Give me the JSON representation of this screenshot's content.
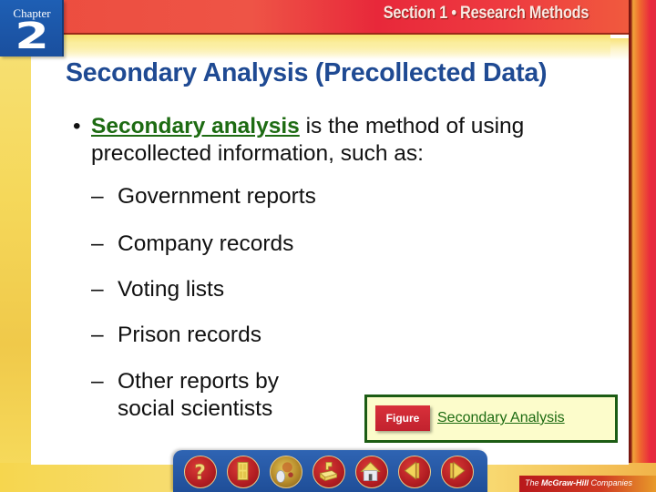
{
  "header": {
    "chapter_label": "Chapter",
    "chapter_number": "2",
    "section_title": "Section 1 • Research Methods"
  },
  "slide": {
    "title": "Secondary Analysis (Precollected Data)",
    "bullet": {
      "marker": "•",
      "term": "Secondary analysis",
      "text_after_term": " is the method of using precollected information, such as:"
    },
    "sub_items": [
      {
        "marker": "–",
        "text": "Government reports"
      },
      {
        "marker": "–",
        "text": "Company records"
      },
      {
        "marker": "–",
        "text": "Voting lists"
      },
      {
        "marker": "–",
        "text": "Prison records"
      },
      {
        "marker": "–",
        "text": "Other reports by social scientists"
      }
    ]
  },
  "figure": {
    "tag_label": "Figure",
    "link_text": "Secondary Analysis"
  },
  "nav": {
    "buttons": [
      {
        "name": "help",
        "icon": "question-mark-icon"
      },
      {
        "name": "exit",
        "icon": "door-icon"
      },
      {
        "name": "web-resources",
        "icon": "globe-mouse-icon"
      },
      {
        "name": "resources",
        "icon": "resource-icon"
      },
      {
        "name": "home",
        "icon": "home-icon"
      },
      {
        "name": "previous",
        "icon": "arrow-left-icon"
      },
      {
        "name": "next",
        "icon": "arrow-right-icon"
      }
    ]
  },
  "publisher": {
    "prefix": "The ",
    "name": "McGraw-Hill",
    "suffix": " Companies"
  },
  "colors": {
    "title_blue": "#1f4a93",
    "term_green": "#1d6b12",
    "header_red": "#ec4c3e",
    "chapter_blue": "#1e5fb4",
    "figure_bg": "#fcfccb",
    "figure_border": "#1c5c14"
  }
}
